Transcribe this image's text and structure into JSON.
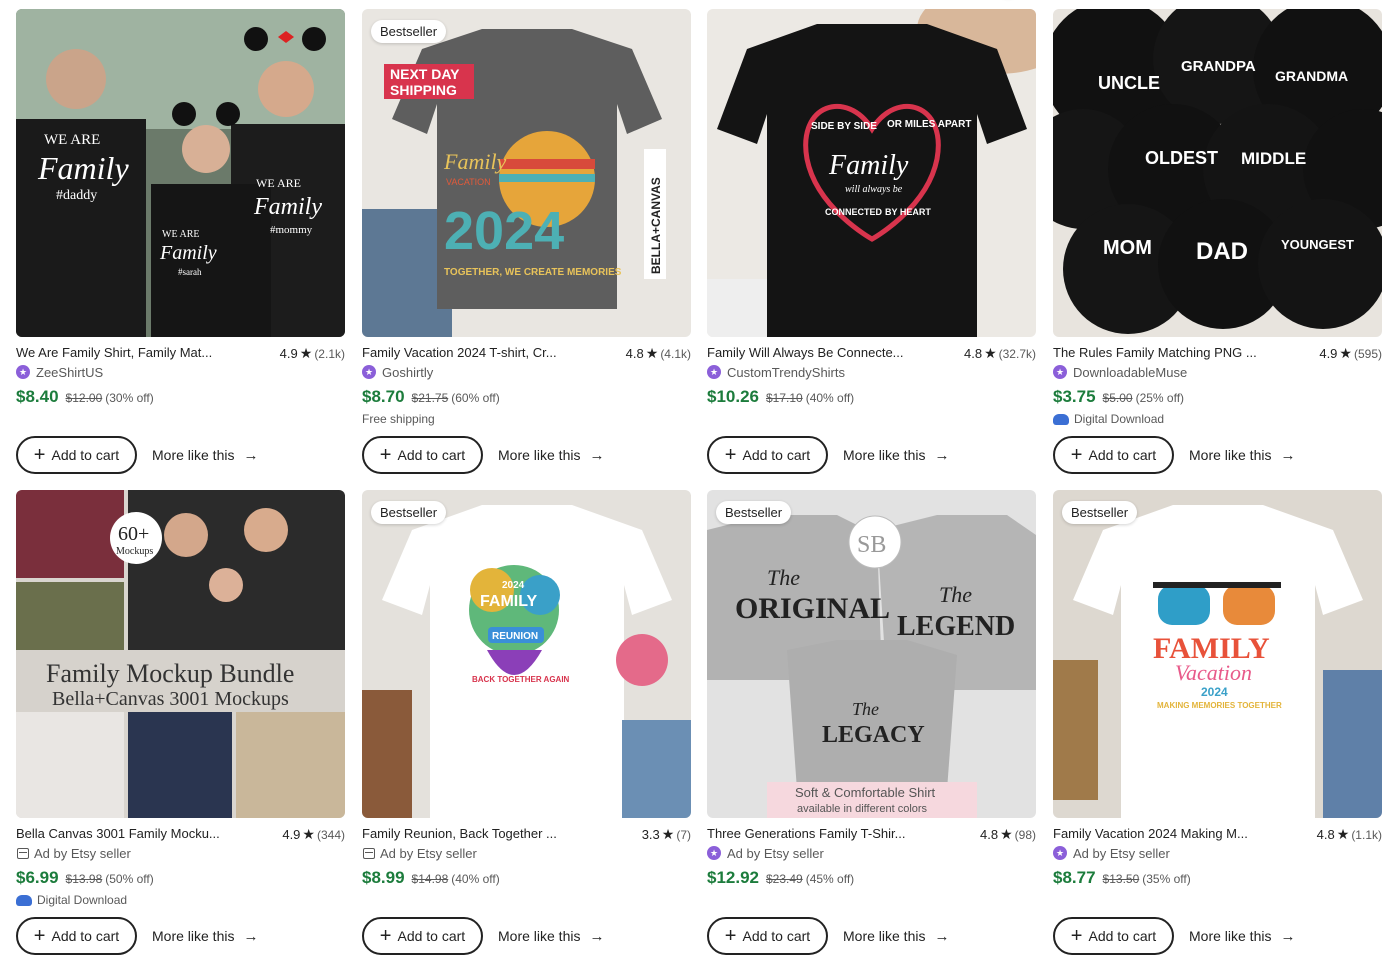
{
  "products": [
    {
      "badge": "",
      "title": "We Are Family Shirt, Family Mat...",
      "rating": "4.9",
      "review_count": "(2.1k)",
      "seller_type": "star",
      "seller": "ZeeShirtUS",
      "price": "$8.40",
      "original_price": "$12.00",
      "discount": "(30% off)",
      "extra": "",
      "add_to_cart_label": "Add to cart",
      "more_like_label": "More like this",
      "image_text": [
        "WE ARE",
        "Family",
        "#daddy",
        "#mommy",
        "#sarah"
      ]
    },
    {
      "badge": "Bestseller",
      "title": "Family Vacation 2024 T-shirt, Cr...",
      "rating": "4.8",
      "review_count": "(4.1k)",
      "seller_type": "star",
      "seller": "Goshirtly",
      "price": "$8.70",
      "original_price": "$21.75",
      "discount": "(60% off)",
      "extra": "Free shipping",
      "add_to_cart_label": "Add to cart",
      "more_like_label": "More like this",
      "image_text": [
        "NEXT DAY",
        "SHIPPING",
        "Family",
        "VACATION",
        "2024",
        "TOGETHER, WE CREATE MEMORIES",
        "BELLA+CANVAS"
      ]
    },
    {
      "badge": "",
      "title": "Family Will Always Be Connecte...",
      "rating": "4.8",
      "review_count": "(32.7k)",
      "seller_type": "star",
      "seller": "CustomTrendyShirts",
      "price": "$10.26",
      "original_price": "$17.10",
      "discount": "(40% off)",
      "extra": "",
      "add_to_cart_label": "Add to cart",
      "more_like_label": "More like this",
      "image_text": [
        "SIDE BY SIDE",
        "OR MILES APART",
        "Family",
        "will always be",
        "CONNECTED",
        "BY HEART"
      ]
    },
    {
      "badge": "",
      "title": "The Rules Family Matching PNG ...",
      "rating": "4.9",
      "review_count": "(595)",
      "seller_type": "star",
      "seller": "DownloadableMuse",
      "price": "$3.75",
      "original_price": "$5.00",
      "discount": "(25% off)",
      "extra": "Digital Download",
      "add_to_cart_label": "Add to cart",
      "more_like_label": "More like this",
      "image_text": [
        "UNCLE",
        "GRANDPA",
        "GRANDMA",
        "OLDEST",
        "MIDDLE",
        "MOM",
        "DAD",
        "YOUNGEST"
      ]
    },
    {
      "badge": "",
      "title": "Bella Canvas 3001 Family Mocku...",
      "rating": "4.9",
      "review_count": "(344)",
      "seller_type": "ad",
      "seller": "Ad by Etsy seller",
      "price": "$6.99",
      "original_price": "$13.98",
      "discount": "(50% off)",
      "extra": "Digital Download",
      "add_to_cart_label": "Add to cart",
      "more_like_label": "More like this",
      "image_text": [
        "60+",
        "Mockups",
        "Family Mockup Bundle",
        "Bella+Canvas 3001 Mockups"
      ]
    },
    {
      "badge": "Bestseller",
      "title": "Family Reunion, Back Together ...",
      "rating": "3.3",
      "review_count": "(7)",
      "seller_type": "ad",
      "seller": "Ad by Etsy seller",
      "price": "$8.99",
      "original_price": "$14.98",
      "discount": "(40% off)",
      "extra": "",
      "add_to_cart_label": "Add to cart",
      "more_like_label": "More like this",
      "image_text": [
        "2024",
        "FAMILY",
        "REUNION",
        "BACK TOGETHER AGAIN"
      ]
    },
    {
      "badge": "Bestseller",
      "title": "Three Generations Family T-Shir...",
      "rating": "4.8",
      "review_count": "(98)",
      "seller_type": "star",
      "seller": "Ad by Etsy seller",
      "price": "$12.92",
      "original_price": "$23.49",
      "discount": "(45% off)",
      "extra": "",
      "add_to_cart_label": "Add to cart",
      "more_like_label": "More like this",
      "image_text": [
        "SB",
        "The",
        "ORIGINAL",
        "LEGEND",
        "LEGACY",
        "Soft & Comfortable Shirt",
        "available in different colors"
      ]
    },
    {
      "badge": "Bestseller",
      "title": "Family Vacation 2024 Making M...",
      "rating": "4.8",
      "review_count": "(1.1k)",
      "seller_type": "star",
      "seller": "Ad by Etsy seller",
      "price": "$8.77",
      "original_price": "$13.50",
      "discount": "(35% off)",
      "extra": "",
      "add_to_cart_label": "Add to cart",
      "more_like_label": "More like this",
      "image_text": [
        "FAMILY",
        "Vacation",
        "2024",
        "MAKING MEMORIES TOGETHER"
      ]
    }
  ],
  "colors": {
    "price_green": "#1c7c3c",
    "text_dark": "#222222",
    "text_muted": "#595959",
    "star_seller_purple": "#8b5fd9",
    "digital_blue": "#3b6fd4"
  }
}
